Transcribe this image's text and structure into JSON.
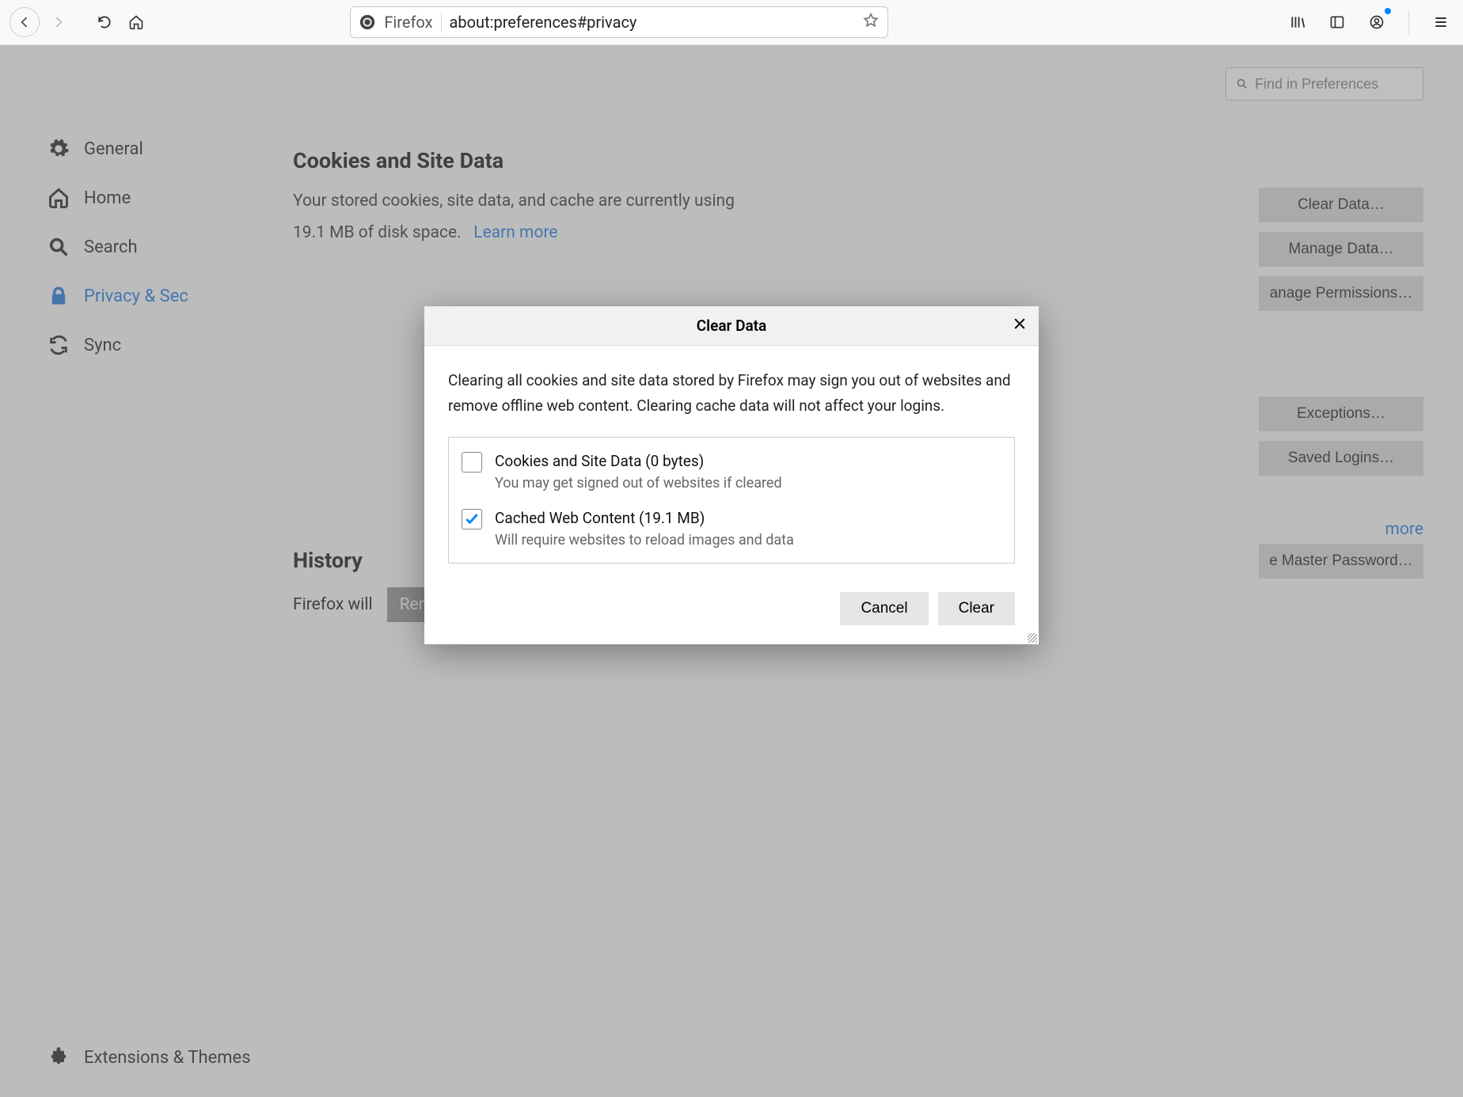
{
  "toolbar": {
    "identity": "Firefox",
    "url": "about:preferences#privacy"
  },
  "search": {
    "placeholder": "Find in Preferences"
  },
  "sidebar": {
    "items": [
      {
        "label": "General"
      },
      {
        "label": "Home"
      },
      {
        "label": "Search"
      },
      {
        "label": "Privacy & Sec"
      },
      {
        "label": "Sync"
      }
    ],
    "bottom": {
      "label": "Extensions & Themes"
    }
  },
  "cookies": {
    "heading": "Cookies and Site Data",
    "line1": "Your stored cookies, site data, and cache are currently using",
    "size": "19.1 MB of disk space.",
    "learn": "Learn more",
    "buttons": {
      "clear": "Clear Data…",
      "manage": "Manage Data…",
      "perms": "anage Permissions…"
    }
  },
  "logins": {
    "buttons": {
      "exceptions": "Exceptions…",
      "saved": "Saved Logins…"
    },
    "more": "more",
    "master": "e Master Password…"
  },
  "history": {
    "heading": "History",
    "label": "Firefox will",
    "select": "Remember history"
  },
  "modal": {
    "title": "Clear Data",
    "desc": "Clearing all cookies and site data stored by Firefox may sign you out of websites and remove offline web content. Clearing cache data will not affect your logins.",
    "opt1": {
      "label": "Cookies and Site Data (0 bytes)",
      "desc": "You may get signed out of websites if cleared"
    },
    "opt2": {
      "label": "Cached Web Content (19.1 MB)",
      "desc": "Will require websites to reload images and data"
    },
    "cancel": "Cancel",
    "clear": "Clear"
  }
}
